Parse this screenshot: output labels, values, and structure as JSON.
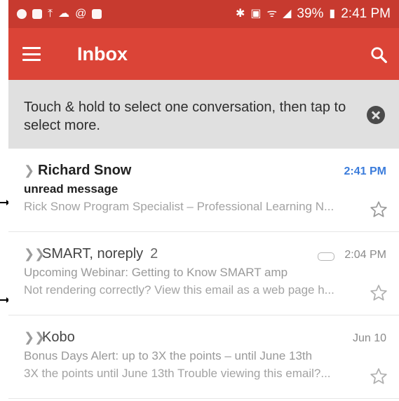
{
  "status_bar": {
    "battery_percent": "39%",
    "time": "2:41 PM",
    "left_icons": [
      "messenger-icon",
      "gallery-icon",
      "upload-icon",
      "weather-icon",
      "at-icon",
      "briefcase-icon"
    ],
    "right_icons": [
      "bluetooth-icon",
      "nfc-icon",
      "wifi-icon",
      "signal-icon",
      "battery-icon"
    ]
  },
  "app_bar": {
    "title": "Inbox"
  },
  "tip_banner": {
    "text": "Touch & hold to select one conversation, then tap to select more."
  },
  "conversations": [
    {
      "sender": "Richard Snow",
      "count": "",
      "time": "2:41 PM",
      "subject": "unread message",
      "snippet": "Rick Snow Program Specialist – Professional Learning N...",
      "unread": true
    },
    {
      "sender": "SMART, noreply",
      "count": "2",
      "time": "2:04 PM",
      "subject": "Upcoming Webinar: Getting to Know SMART amp",
      "snippet": "Not rendering correctly? View this email as a web page h...",
      "unread": false
    },
    {
      "sender": "Kobo",
      "count": "",
      "time": "Jun 10",
      "subject": "Bonus Days Alert: up to 3X the points – until June 13th",
      "snippet": "3X the points until June 13th Trouble viewing this email?...",
      "unread": false
    }
  ],
  "colors": {
    "status_bar": "#c73a2f",
    "app_bar": "#db4437",
    "tip_background": "#e0e0e0",
    "unread_time": "#3b7cdb"
  }
}
